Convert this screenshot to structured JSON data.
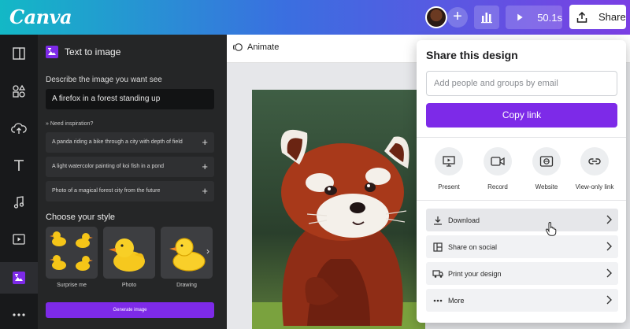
{
  "topbar": {
    "logo": "Canva",
    "present_time": "50.1s",
    "share_label": "Share"
  },
  "panel": {
    "title": "Text to image",
    "describe_label": "Describe the image you want see",
    "prompt_value": "A firefox in a forest standing up",
    "inspiration_label": "Need inspiration?",
    "suggestions": [
      "A panda riding a bike through a city with depth of field",
      "A light watercolor painting of koi fish in a pond",
      "Photo of a magical forest city from the future"
    ],
    "style_label": "Choose your style",
    "styles": [
      "Surprise me",
      "Photo",
      "Drawing"
    ],
    "generate_label": "Generate image"
  },
  "canvas": {
    "animate_label": "Animate"
  },
  "share": {
    "title": "Share this design",
    "email_placeholder": "Add people and groups by email",
    "copy_link": "Copy link",
    "quick_actions": [
      "Present",
      "Record",
      "Website",
      "View-only link"
    ],
    "rows": [
      "Download",
      "Share on social",
      "Print your design",
      "More"
    ]
  },
  "colors": {
    "accent": "#7d2ae8",
    "topbar_start": "#13b8c6",
    "topbar_end": "#7b3fe4",
    "panel_bg": "#252627"
  }
}
